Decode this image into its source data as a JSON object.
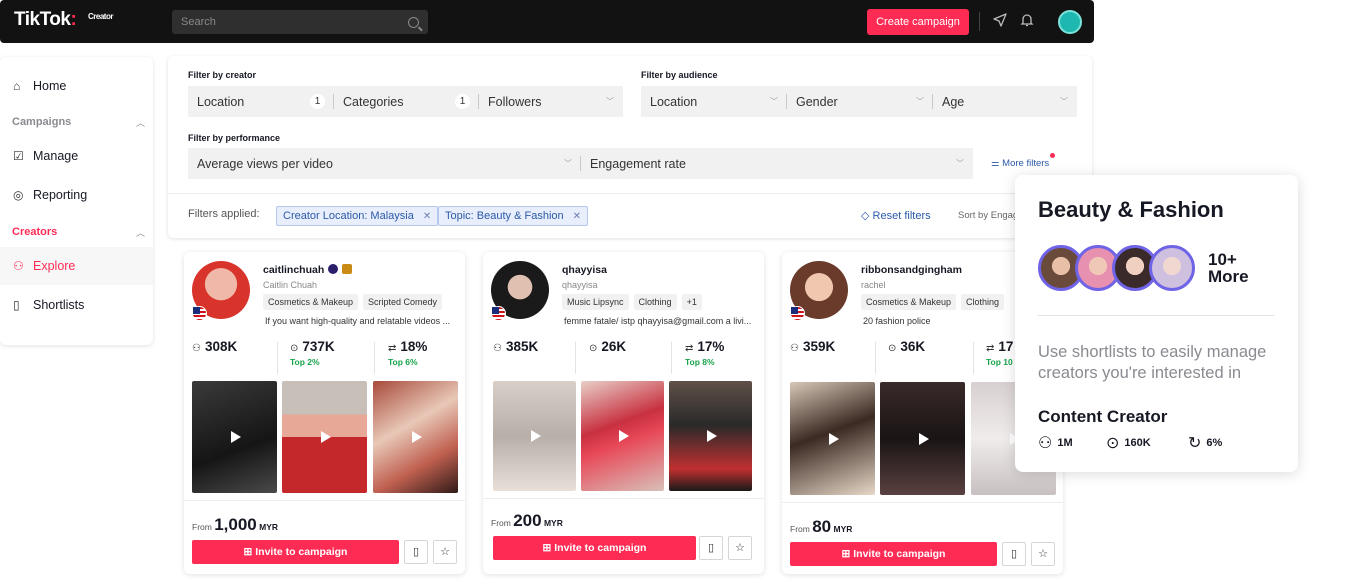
{
  "topbar": {
    "logo": "TikTok",
    "logo_sub": "Creator",
    "search_placeholder": "Search",
    "create_label": "Create campaign"
  },
  "sidebar": {
    "home": "Home",
    "campaigns_head": "Campaigns",
    "manage": "Manage",
    "reporting": "Reporting",
    "creators_head": "Creators",
    "explore": "Explore",
    "shortlists": "Shortlists"
  },
  "filters": {
    "by_creator_label": "Filter by creator",
    "by_audience_label": "Filter by audience",
    "by_performance_label": "Filter by performance",
    "creator": [
      {
        "label": "Location",
        "count": "1"
      },
      {
        "label": "Categories",
        "count": "1"
      },
      {
        "label": "Followers",
        "count": ""
      }
    ],
    "audience": [
      {
        "label": "Location"
      },
      {
        "label": "Gender"
      },
      {
        "label": "Age"
      }
    ],
    "performance": [
      {
        "label": "Average views per video"
      },
      {
        "label": "Engagement rate"
      }
    ],
    "more_filters": "More filters",
    "applied_label": "Filters applied:",
    "chips": [
      "Creator Location: Malaysia",
      "Topic: Beauty & Fashion"
    ],
    "reset": "Reset filters",
    "sort_by": "Sort by Engag"
  },
  "cards": [
    {
      "handle": "caitlinchuah",
      "name": "Caitlin Chuah",
      "tags": [
        "Cosmetics & Makeup",
        "Scripted Comedy"
      ],
      "bio": "If you want high-quality and relatable videos ...",
      "followers": "308K",
      "views": "737K",
      "views_top": "Top 2%",
      "engagement": "18%",
      "engagement_top": "Top 6%",
      "price_prefix": "From",
      "price": "1,000",
      "currency": "MYR",
      "invite": "Invite to campaign"
    },
    {
      "handle": "qhayyisa",
      "name": "qhayyisa",
      "tags": [
        "Music Lipsync",
        "Clothing",
        "+1"
      ],
      "bio": "femme fatale/ istp qhayyisa@gmail.com a livi...",
      "followers": "385K",
      "views": "26K",
      "views_top": "",
      "engagement": "17%",
      "engagement_top": "Top 8%",
      "price_prefix": "From",
      "price": "200",
      "currency": "MYR",
      "invite": "Invite to campaign"
    },
    {
      "handle": "ribbonsandgingham",
      "name": "rachel",
      "tags": [
        "Cosmetics & Makeup",
        "Clothing"
      ],
      "bio": "20 fashion police",
      "followers": "359K",
      "views": "36K",
      "views_top": "",
      "engagement": "17",
      "engagement_top": "Top 10",
      "price_prefix": "From",
      "price": "80",
      "currency": "MYR",
      "invite": "Invite to campaign"
    }
  ],
  "promo": {
    "title": "Beauty & Fashion",
    "more": "10+ More",
    "text": "Use shortlists to easily manage creators you're interested in",
    "subtitle": "Content Creator",
    "stat_followers": "1M",
    "stat_views": "160K",
    "stat_engagement": "6%"
  },
  "colors": {
    "accent": "#fe2c55",
    "link": "#2b5aa8",
    "positive": "#16a34a"
  }
}
